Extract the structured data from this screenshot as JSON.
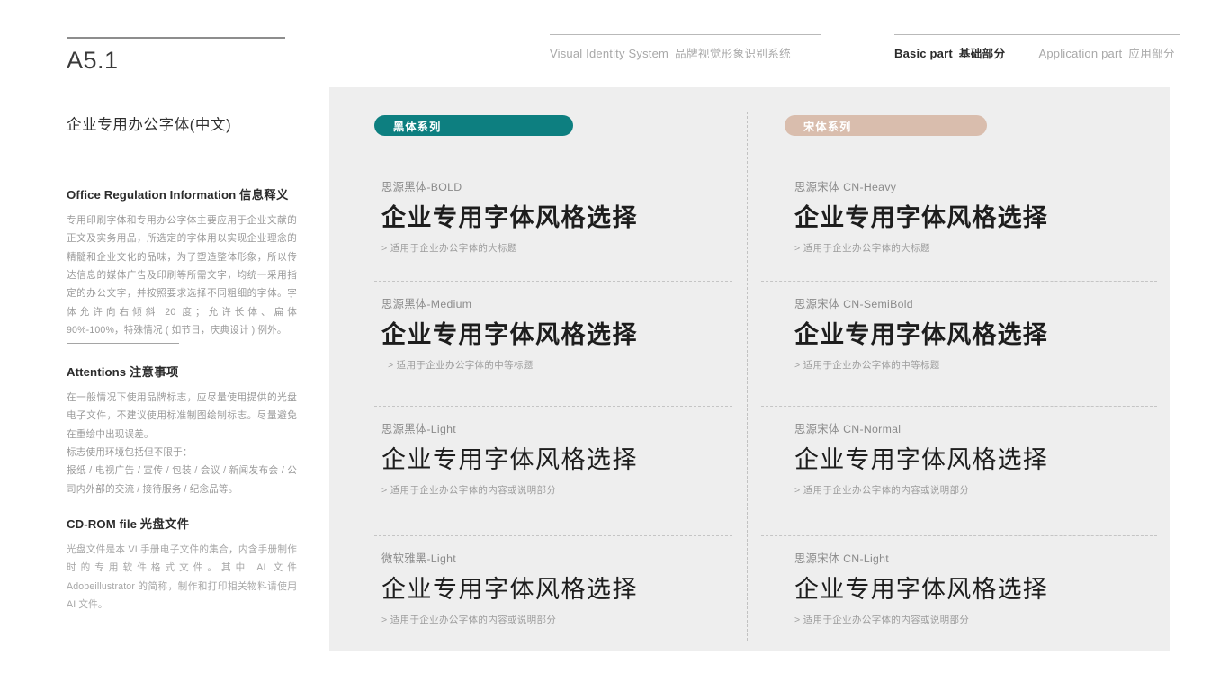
{
  "header": {
    "nav_left": [
      {
        "en": "Visual Identity System",
        "cn": "品牌视觉形象识别系统",
        "state": "muted"
      }
    ],
    "nav_right": [
      {
        "en": "Basic part",
        "cn": "基础部分",
        "state": "active"
      },
      {
        "en": "Application part",
        "cn": "应用部分",
        "state": "muted"
      }
    ]
  },
  "sidebar": {
    "code": "A5.1",
    "section_title": "企业专用办公字体(中文)",
    "blocks": [
      {
        "heading_en": "Office Regulation Information",
        "heading_cn": "信息释义",
        "body": "专用印刷字体和专用办公字体主要应用于企业文献的正文及实务用品，所选定的字体用以实现企业理念的精髓和企业文化的品味，为了塑造整体形象，所以传达信息的媒体广告及印刷等所需文字，均统一采用指定的办公文字，并按照要求选择不同粗细的字体。字体允许向右倾斜 20 度；允许长体、扁体 90%-100%，特殊情况 ( 如节日，庆典设计 ) 例外。"
      },
      {
        "heading_en": "Attentions",
        "heading_cn": "注意事项",
        "body_1": "在一般情况下使用品牌标志，应尽量使用提供的光盘电子文件，不建议使用标准制图绘制标志。尽量避免在重绘中出现误差。",
        "body_2": "标志使用环境包括但不限于：",
        "body_3": "报纸 / 电视广告 / 宣传 / 包装 / 会议 / 新闻发布会 / 公司内外部的交流 / 接待服务 / 纪念品等。"
      },
      {
        "heading_en": "CD-ROM file",
        "heading_cn": "光盘文件",
        "body": "光盘文件是本 VI 手册电子文件的集合，内含手册制作时的专用软件格式文件。其中 AI 文件 Adobeillustrator 的简称，制作和打印相关物料请使用 AI 文件。"
      }
    ]
  },
  "panel": {
    "columns": [
      {
        "pill_label": "黑体系列",
        "pill_color": "#0d7f80",
        "specimens": [
          {
            "name": "思源黑体-BOLD",
            "sample": "企业专用字体风格选择",
            "caption": "> 适用于企业办公字体的大标题"
          },
          {
            "name": "思源黑体-Medium",
            "sample": "企业专用字体风格选择",
            "caption": "> 适用于企业办公字体的中等标题"
          },
          {
            "name": "思源黑体-Light",
            "sample": "企业专用字体风格选择",
            "caption": "> 适用于企业办公字体的内容或说明部分"
          },
          {
            "name": "微软雅黑-Light",
            "sample": "企业专用字体风格选择",
            "caption": "> 适用于企业办公字体的内容或说明部分"
          }
        ]
      },
      {
        "pill_label": "宋体系列",
        "pill_color": "#d9bdad",
        "specimens": [
          {
            "name": "思源宋体 CN-Heavy",
            "sample": "企业专用字体风格选择",
            "caption": "> 适用于企业办公字体的大标题"
          },
          {
            "name": "思源宋体 CN-SemiBold",
            "sample": "企业专用字体风格选择",
            "caption": "> 适用于企业办公字体的中等标题"
          },
          {
            "name": "思源宋体 CN-Normal",
            "sample": "企业专用字体风格选择",
            "caption": "> 适用于企业办公字体的内容或说明部分"
          },
          {
            "name": "思源宋体 CN-Light",
            "sample": "企业专用字体风格选择",
            "caption": "> 适用于企业办公字体的内容或说明部分"
          }
        ]
      }
    ]
  },
  "colors": {
    "panel_background": "#eeeeee",
    "teal_accent": "#0d7f80",
    "tan_accent": "#d9bdad",
    "page_background": "#ffffff"
  }
}
